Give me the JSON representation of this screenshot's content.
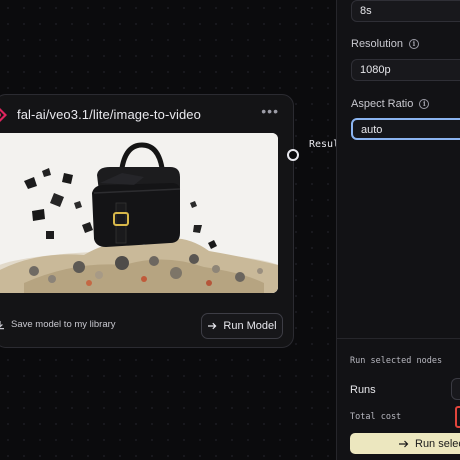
{
  "node": {
    "title": "fal-ai/veo3.1/lite/image-to-video",
    "menu_icon": "more-horizontal-icon",
    "save_label": "Save model to my library",
    "run_label": "Run Model",
    "run_icon": "arrow-right-icon",
    "brand_color": "#e0245e"
  },
  "port": {
    "label": "Result"
  },
  "panel": {
    "duration_value": "8s",
    "resolution_label": "Resolution",
    "resolution_value": "1080p",
    "aspect_label": "Aspect Ratio",
    "aspect_value": "auto",
    "run_selected_title": "Run selected nodes",
    "runs_label": "Runs",
    "cost_label": "Total cost",
    "run_selected_button": "Run selected",
    "button_color": "#ece7bf",
    "focus_color": "#8bb4f0"
  }
}
